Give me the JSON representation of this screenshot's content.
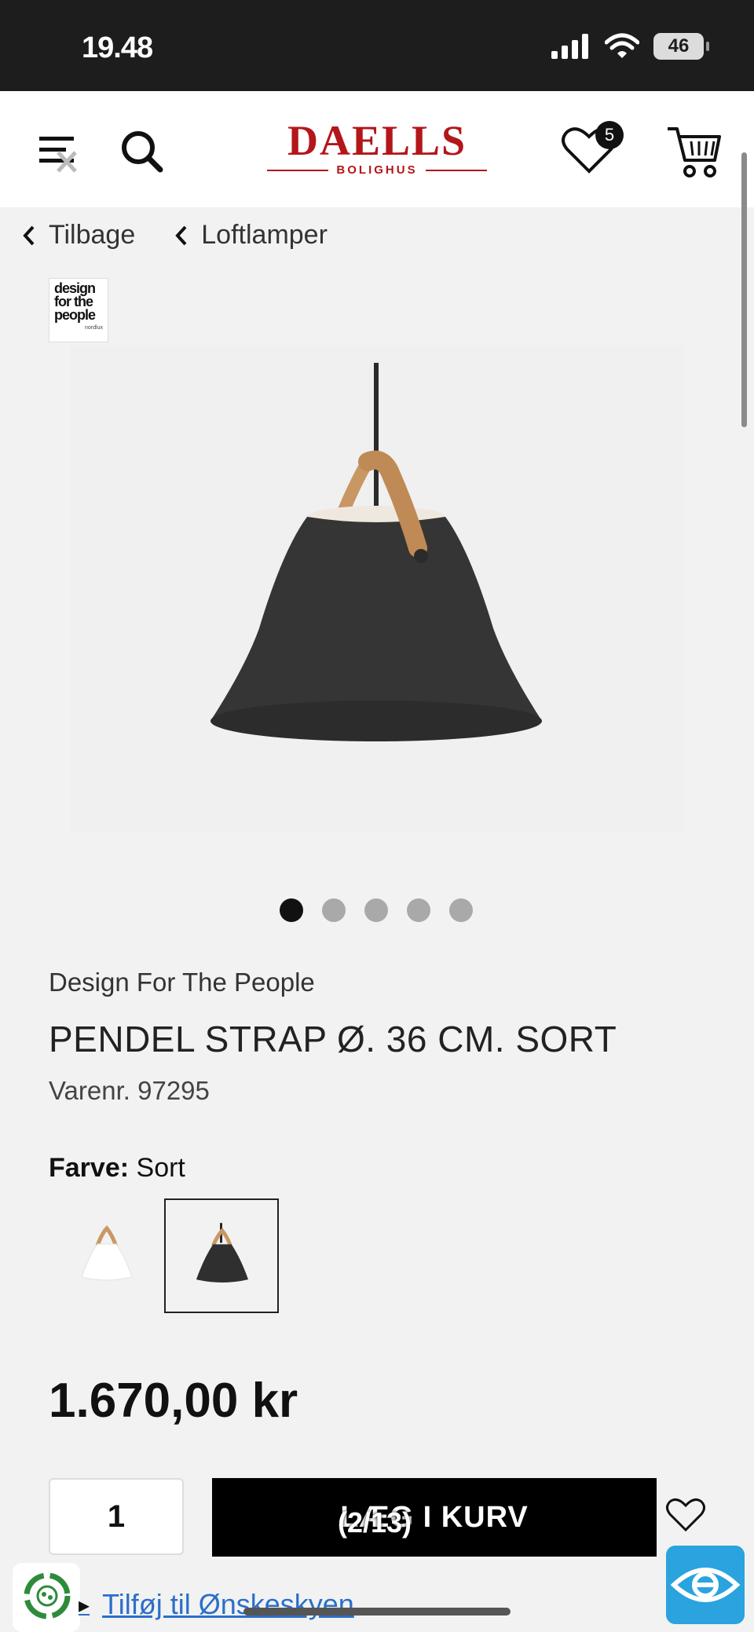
{
  "status_bar": {
    "time": "19.48",
    "battery": "46"
  },
  "header": {
    "logo_name": "DAELLS",
    "logo_sub": "BOLIGHUS",
    "wishlist_count": "5"
  },
  "breadcrumb": [
    {
      "label": "Tilbage"
    },
    {
      "label": "Loftlamper"
    }
  ],
  "brand_badge": {
    "text": "design\nfor the\npeople",
    "sub": "nordlux"
  },
  "gallery": {
    "slides": 5,
    "active": 1,
    "page_indicator": "(2/13)"
  },
  "product": {
    "brand": "Design For The People",
    "title": "PENDEL STRAP Ø. 36 CM. SORT",
    "sku_label": "Varenr.",
    "sku": "97295",
    "color_label": "Farve:",
    "color_value": "Sort",
    "swatches": [
      {
        "name": "Hvid",
        "color": "#ffffff",
        "selected": false
      },
      {
        "name": "Sort",
        "color": "#2f2f2f",
        "selected": true
      }
    ],
    "price": "1.670,00 kr"
  },
  "purchase": {
    "quantity": "1",
    "add_to_cart": "LÆG I KURV",
    "wishcloud_link": "Tilføj til Ønskeskyen"
  },
  "colors": {
    "brand_red": "#b3161b",
    "link_blue": "#2a6fc9",
    "accessibility_blue": "#2aa3de",
    "leather": "#c99764"
  }
}
